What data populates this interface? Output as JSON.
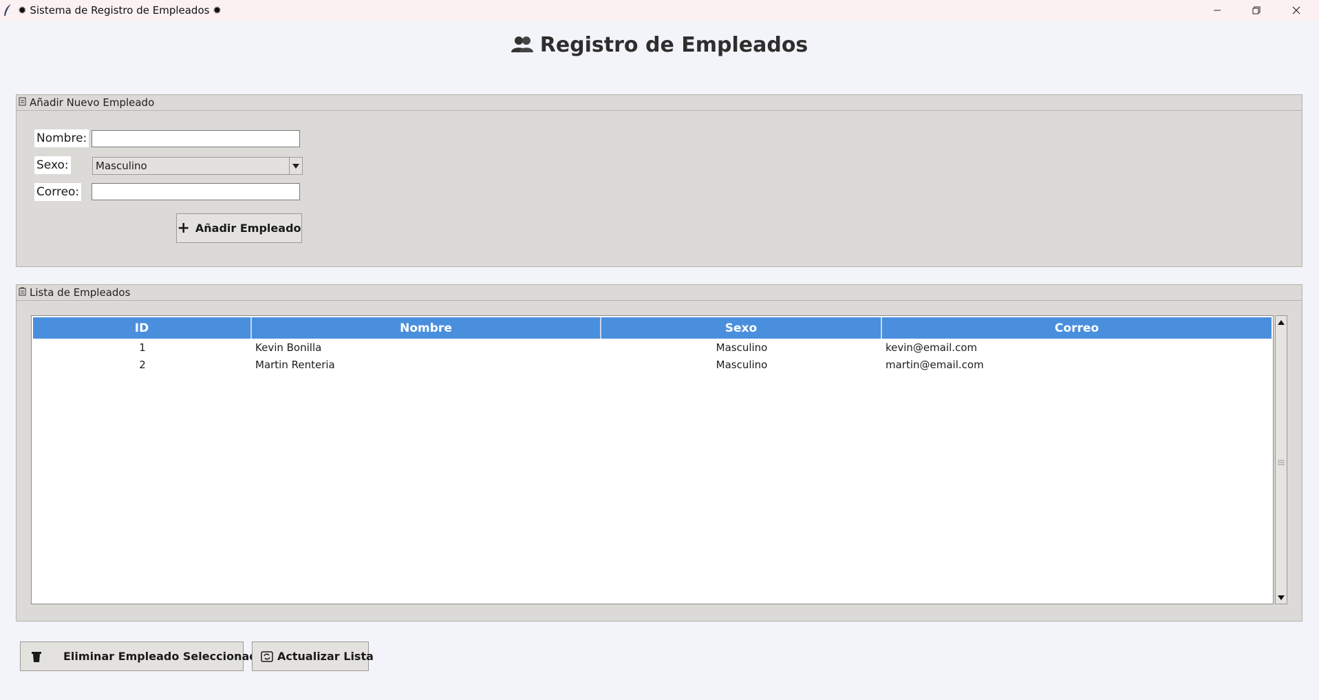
{
  "window": {
    "title": "Sistema de Registro de Empleados",
    "title_icon": "gear-icon",
    "controls": {
      "minimize": "–",
      "maximize": "❐",
      "close": "✕"
    }
  },
  "header": {
    "title": "Registro de Empleados",
    "icon": "users-icon"
  },
  "add_section": {
    "title": "Añadir Nuevo Empleado",
    "icon": "memo-icon",
    "nombre_label": "Nombre:",
    "nombre_value": "",
    "sexo_label": "Sexo:",
    "sexo_value": "Masculino",
    "correo_label": "Correo:",
    "correo_value": "",
    "add_button": "Añadir Empleado",
    "add_button_icon": "+"
  },
  "list_section": {
    "title": "Lista de Empleados",
    "icon": "clipboard-icon",
    "columns": [
      "ID",
      "Nombre",
      "Sexo",
      "Correo"
    ],
    "rows": [
      {
        "id": "1",
        "nombre": "Kevin Bonilla",
        "sexo": "Masculino",
        "correo": "kevin@email.com"
      },
      {
        "id": "2",
        "nombre": "Martin Renteria",
        "sexo": "Masculino",
        "correo": "martin@email.com"
      }
    ]
  },
  "actions": {
    "delete_button": "Eliminar Empleado Seleccionado",
    "refresh_button": "Actualizar Lista"
  },
  "colors": {
    "header_accent": "#4a8fde",
    "frame_bg": "#dcdad6",
    "page_bg": "#f3f4f9"
  }
}
